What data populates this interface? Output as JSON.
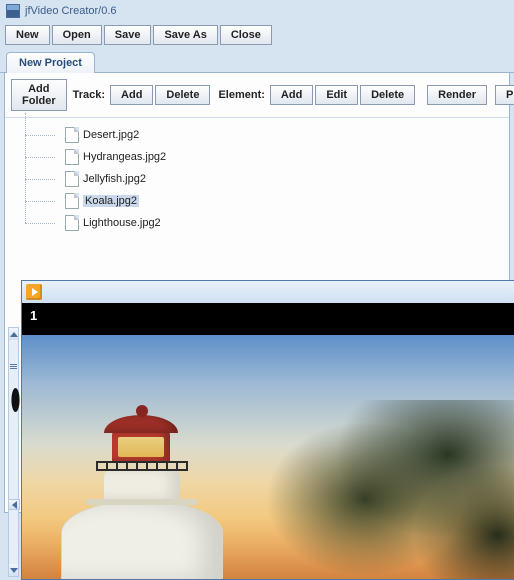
{
  "app": {
    "title": "jfVideo Creator/0.6"
  },
  "toolbar": {
    "new": "New",
    "open": "Open",
    "save": "Save",
    "save_as": "Save As",
    "close": "Close"
  },
  "tabs": {
    "active": "New Project"
  },
  "project_toolbar": {
    "add_folder": "Add Folder",
    "track_label": "Track:",
    "track_add": "Add",
    "track_delete": "Delete",
    "element_label": "Element:",
    "element_add": "Add",
    "element_edit": "Edit",
    "element_delete": "Delete",
    "render": "Render",
    "play": "Play",
    "preview_partial": "P"
  },
  "tree": {
    "items": [
      {
        "name": "Desert.jpg2",
        "selected": false
      },
      {
        "name": "Hydrangeas.jpg2",
        "selected": false
      },
      {
        "name": "Jellyfish.jpg2",
        "selected": false
      },
      {
        "name": "Koala.jpg2",
        "selected": true
      },
      {
        "name": "Lighthouse.jpg2",
        "selected": false
      }
    ]
  },
  "preview": {
    "frame_number": "1"
  }
}
